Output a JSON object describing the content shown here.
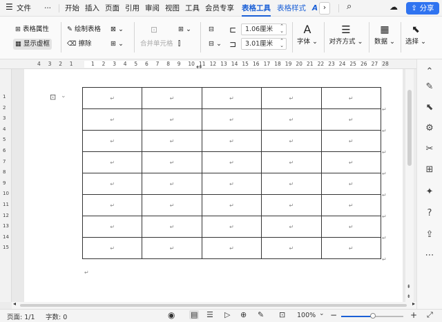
{
  "tabs": {
    "menu_icon": "menu-icon",
    "file": "文件",
    "more": "···",
    "items": [
      "开始",
      "插入",
      "页面",
      "引用",
      "审阅",
      "视图",
      "工具",
      "会员专享",
      "表格工具",
      "表格样式"
    ],
    "active_index": 8,
    "share": "分享"
  },
  "ribbon": {
    "table_props": "表格属性",
    "show_gridlines": "显示虚框",
    "draw_table": "绘制表格",
    "erase": "擦除",
    "merge_cells": "合并单元格",
    "row_height": "1.06厘米",
    "col_width": "3.01厘米",
    "font": "字体",
    "align": "对齐方式",
    "data": "数据",
    "select": "选择"
  },
  "ruler_numbers": [
    "4",
    "3",
    "2",
    "1",
    "",
    "1",
    "2",
    "3",
    "4",
    "5",
    "6",
    "7",
    "8",
    "9",
    "10",
    "11",
    "12",
    "13",
    "14",
    "15",
    "16",
    "17",
    "18",
    "19",
    "20",
    "21",
    "22",
    "23",
    "24",
    "25",
    "26",
    "27",
    "28"
  ],
  "left_ruler_numbers": [
    "1",
    "2",
    "3",
    "4",
    "5",
    "6",
    "7",
    "8",
    "9",
    "10",
    "11",
    "12",
    "13",
    "14",
    "15"
  ],
  "table": {
    "rows": 8,
    "cols": 5,
    "cell_mark": "↵"
  },
  "status": {
    "page": "页面: 1/1",
    "words": "字数: 0",
    "zoom": "100%"
  },
  "colors": {
    "accent": "#1a5fd6",
    "share_bg": "#2f73f0"
  }
}
